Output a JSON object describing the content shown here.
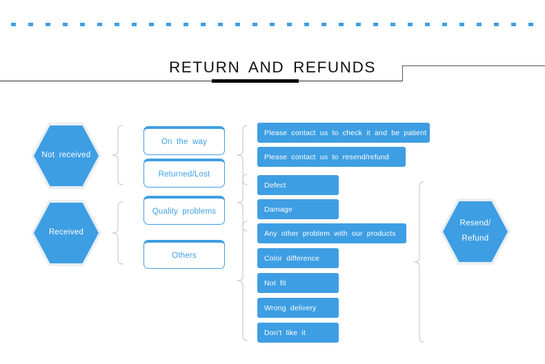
{
  "page": {
    "title": "RETURN  AND  REFUNDS",
    "accent_color": "#3e9ee3",
    "brace_color": "#c9cdd1",
    "rule_color": "#2b2b2b",
    "bar_color": "#000000"
  },
  "flow": {
    "stage1": [
      {
        "label": "Not  received"
      },
      {
        "label": "Received"
      }
    ],
    "stage2": [
      {
        "label": "On  the  way"
      },
      {
        "label": "Returned/Lost"
      },
      {
        "label": "Quality  problems"
      },
      {
        "label": "Others"
      }
    ],
    "stage3": [
      {
        "label": "Please  contact  us  to  check  it  and  be  patient"
      },
      {
        "label": "Please  contact  us  to  resend/refund"
      },
      {
        "label": "Defect"
      },
      {
        "label": "Damage"
      },
      {
        "label": "Any  other  problem  with  our  products"
      },
      {
        "label": "Color  difference"
      },
      {
        "label": "Not  fit"
      },
      {
        "label": "Wrong  delivery"
      },
      {
        "label": "Don’t  like  it"
      }
    ],
    "stage4": {
      "line1": "Resend/",
      "line2": "Refund"
    }
  }
}
